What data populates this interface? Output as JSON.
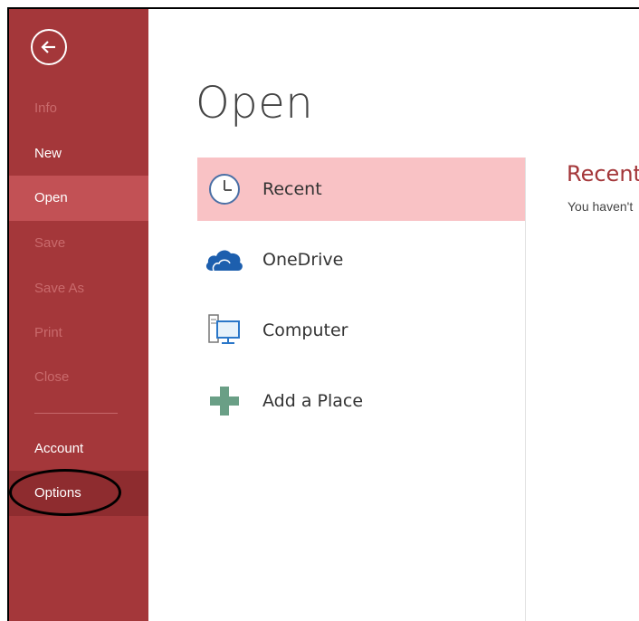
{
  "sidebar": {
    "items": [
      {
        "label": "Info",
        "state": "disabled"
      },
      {
        "label": "New",
        "state": "enabled"
      },
      {
        "label": "Open",
        "state": "selected"
      },
      {
        "label": "Save",
        "state": "disabled"
      },
      {
        "label": "Save As",
        "state": "disabled"
      },
      {
        "label": "Print",
        "state": "disabled"
      },
      {
        "label": "Close",
        "state": "disabled"
      },
      {
        "label": "Account",
        "state": "enabled"
      },
      {
        "label": "Options",
        "state": "enabled"
      }
    ],
    "back_icon": "back-arrow-icon"
  },
  "main": {
    "title": "Open",
    "places": [
      {
        "label": "Recent",
        "icon": "clock-icon",
        "selected": true
      },
      {
        "label": "OneDrive",
        "icon": "cloud-icon",
        "selected": false
      },
      {
        "label": "Computer",
        "icon": "computer-icon",
        "selected": false
      },
      {
        "label": "Add a Place",
        "icon": "plus-icon",
        "selected": false
      }
    ],
    "recent_pane": {
      "title": "Recent",
      "message": "You haven't"
    }
  },
  "colors": {
    "sidebar": "#a4373a",
    "sidebar_selected": "#c25155",
    "place_selected": "#f9c2c5",
    "accent_text": "#a4373a"
  }
}
